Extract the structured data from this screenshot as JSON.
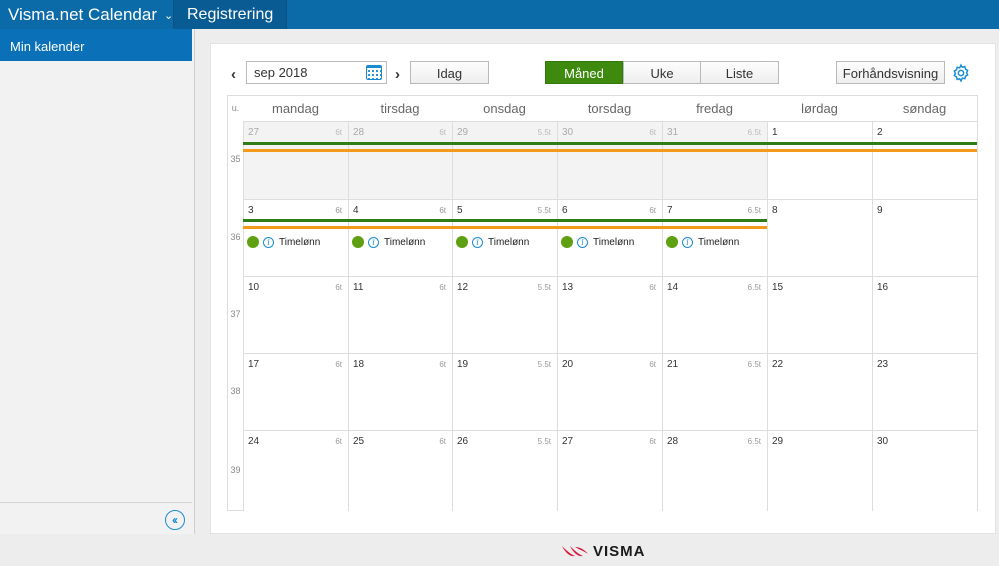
{
  "topbar": {
    "app_title": "Visma.net Calendar",
    "tab_label": "Registrering"
  },
  "sidebar": {
    "items": [
      {
        "label": "Min kalender"
      }
    ],
    "collapse_icon": "double-chevron-left-icon"
  },
  "toolbar": {
    "date_value": "sep 2018",
    "today_label": "Idag",
    "views": [
      {
        "label": "Måned",
        "active": true
      },
      {
        "label": "Uke",
        "active": false
      },
      {
        "label": "Liste",
        "active": false
      }
    ],
    "preview_label": "Forhåndsvisning"
  },
  "calendar": {
    "week_header": "u.",
    "weekdays": [
      "mandag",
      "tirsdag",
      "onsdag",
      "torsdag",
      "fredag",
      "lørdag",
      "søndag"
    ],
    "weeks": [
      {
        "number": "35",
        "days": [
          {
            "day": "27",
            "hours": "6t",
            "other": true
          },
          {
            "day": "28",
            "hours": "6t",
            "other": true
          },
          {
            "day": "29",
            "hours": "5.5t",
            "other": true
          },
          {
            "day": "30",
            "hours": "6t",
            "other": true
          },
          {
            "day": "31",
            "hours": "6.5t",
            "other": true
          },
          {
            "day": "1",
            "hours": "",
            "other": false
          },
          {
            "day": "2",
            "hours": "",
            "other": false
          }
        ]
      },
      {
        "number": "36",
        "days": [
          {
            "day": "3",
            "hours": "6t",
            "other": false,
            "event": "Timelønn"
          },
          {
            "day": "4",
            "hours": "6t",
            "other": false,
            "event": "Timelønn"
          },
          {
            "day": "5",
            "hours": "5.5t",
            "other": false,
            "event": "Timelønn"
          },
          {
            "day": "6",
            "hours": "6t",
            "other": false,
            "event": "Timelønn"
          },
          {
            "day": "7",
            "hours": "6.5t",
            "other": false,
            "event": "Timelønn"
          },
          {
            "day": "8",
            "hours": "",
            "other": false
          },
          {
            "day": "9",
            "hours": "",
            "other": false
          }
        ]
      },
      {
        "number": "37",
        "days": [
          {
            "day": "10",
            "hours": "6t",
            "other": false
          },
          {
            "day": "11",
            "hours": "6t",
            "other": false
          },
          {
            "day": "12",
            "hours": "5.5t",
            "other": false
          },
          {
            "day": "13",
            "hours": "6t",
            "other": false
          },
          {
            "day": "14",
            "hours": "6.5t",
            "other": false
          },
          {
            "day": "15",
            "hours": "",
            "other": false
          },
          {
            "day": "16",
            "hours": "",
            "other": false
          }
        ]
      },
      {
        "number": "38",
        "days": [
          {
            "day": "17",
            "hours": "6t",
            "other": false
          },
          {
            "day": "18",
            "hours": "6t",
            "other": false
          },
          {
            "day": "19",
            "hours": "5.5t",
            "other": false
          },
          {
            "day": "20",
            "hours": "6t",
            "other": false
          },
          {
            "day": "21",
            "hours": "6.5t",
            "other": false
          },
          {
            "day": "22",
            "hours": "",
            "other": false
          },
          {
            "day": "23",
            "hours": "",
            "other": false
          }
        ]
      },
      {
        "number": "39",
        "days": [
          {
            "day": "24",
            "hours": "6t",
            "other": false
          },
          {
            "day": "25",
            "hours": "6t",
            "other": false
          },
          {
            "day": "26",
            "hours": "5.5t",
            "other": false
          },
          {
            "day": "27",
            "hours": "6t",
            "other": false
          },
          {
            "day": "28",
            "hours": "6.5t",
            "other": false
          },
          {
            "day": "29",
            "hours": "",
            "other": false
          },
          {
            "day": "30",
            "hours": "",
            "other": false
          }
        ]
      }
    ],
    "colors": {
      "green_bar": "#2e7d16",
      "orange_bar": "#f39a1b",
      "event_dot": "#5fa012",
      "active_view": "#3e8a0f",
      "brand_blue": "#0b6aa8"
    }
  },
  "footer": {
    "brand": "VISMA"
  }
}
